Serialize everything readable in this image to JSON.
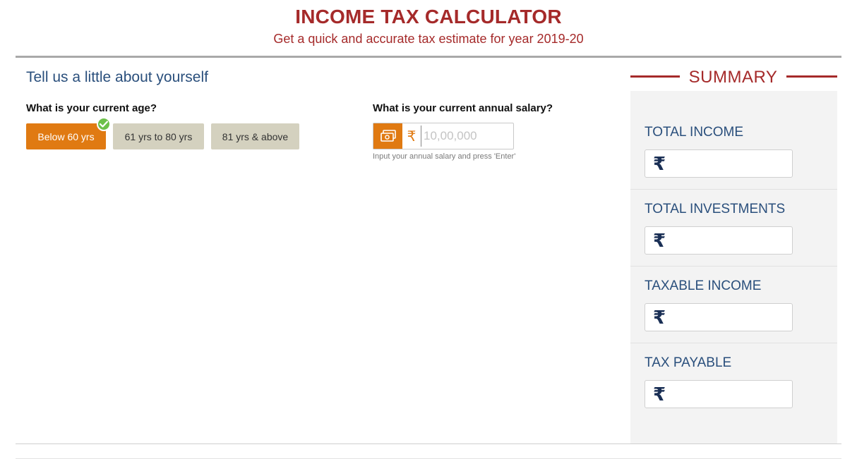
{
  "header": {
    "title": "INCOME TAX CALCULATOR",
    "subtitle": "Get a quick and accurate tax estimate for year 2019-20"
  },
  "about": {
    "heading": "Tell us a little about yourself",
    "age_question": "What is your current age?",
    "age_options": [
      {
        "label": "Below 60 yrs",
        "selected": true
      },
      {
        "label": "61 yrs to 80 yrs",
        "selected": false
      },
      {
        "label": "81 yrs & above",
        "selected": false
      }
    ],
    "salary_question": "What is your current annual salary?",
    "salary_currency": "₹",
    "salary_value": "",
    "salary_placeholder": "10,00,000",
    "salary_hint": "Input your annual salary and press 'Enter'"
  },
  "summary": {
    "title": "SUMMARY",
    "items": [
      {
        "label": "TOTAL INCOME",
        "currency": "₹",
        "value": ""
      },
      {
        "label": "TOTAL INVESTMENTS",
        "currency": "₹",
        "value": ""
      },
      {
        "label": "TAXABLE INCOME",
        "currency": "₹",
        "value": ""
      },
      {
        "label": "TAX PAYABLE",
        "currency": "₹",
        "value": ""
      }
    ]
  },
  "colors": {
    "brand_red": "#a52a2a",
    "accent_orange": "#e07a12",
    "heading_blue": "#2a4f7c",
    "check_green": "#6cc04a"
  },
  "icons": {
    "selected_check": "check-circle-icon",
    "salary": "money-icon"
  }
}
